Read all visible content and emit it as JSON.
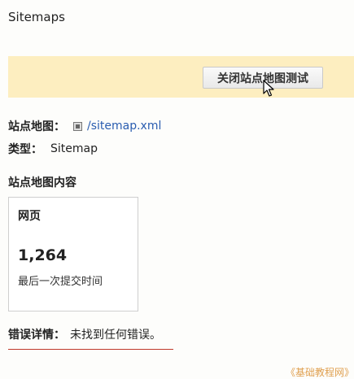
{
  "header": {
    "title": "Sitemaps"
  },
  "banner": {
    "button_label": "关闭站点地图测试"
  },
  "details": {
    "sitemap_label": "站点地图：",
    "sitemap_link": "/sitemap.xml",
    "type_label": "类型：",
    "type_value": "Sitemap"
  },
  "content": {
    "section_title": "站点地图内容",
    "card": {
      "title": "网页",
      "value": "1,264",
      "subtitle": "最后一次提交时间"
    }
  },
  "error": {
    "label": "错误详情：",
    "message": "未找到任何错误。"
  },
  "watermark": "《基础教程网》",
  "colors": {
    "banner_bg": "#fdeec0",
    "link": "#2a5db0",
    "underline": "#c0392b",
    "watermark": "#e0a050"
  }
}
